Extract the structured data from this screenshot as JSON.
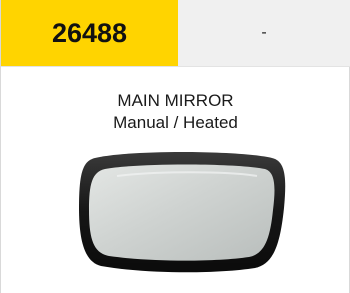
{
  "header": {
    "part_number": "26488",
    "note": "-"
  },
  "product": {
    "title": "MAIN MIRROR",
    "subtitle": "Manual / Heated"
  },
  "colors": {
    "part_number_bg": "#ffd400",
    "note_bg": "#f0f0f0",
    "mirror_frame": "#1b1b1b",
    "mirror_glass": "#cdd1cf"
  },
  "image": {
    "icon": "mirror-image"
  }
}
